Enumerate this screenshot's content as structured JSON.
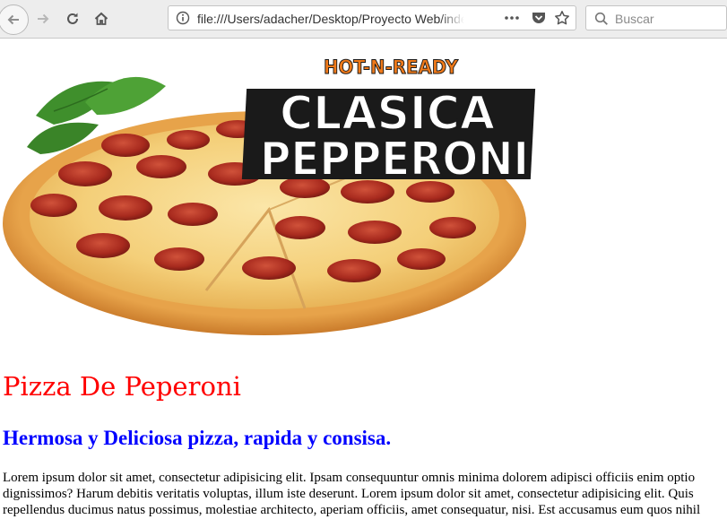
{
  "browser": {
    "url": "file:///Users/adacher/Desktop/Proyecto Web/index.html",
    "search_placeholder": "Buscar",
    "icons": [
      "back-arrow-icon",
      "forward-arrow-icon",
      "reload-icon",
      "home-icon",
      "info-icon",
      "more-dots-icon",
      "pocket-icon",
      "star-icon",
      "search-icon"
    ]
  },
  "hero": {
    "logo_top": "HOT-N-READY",
    "logo_line1": "CLASICA",
    "logo_line2": "PEPPERONI"
  },
  "page": {
    "title": "Pizza De Peperoni",
    "subtitle": "Hermosa y Deliciosa pizza, rapida y consisa.",
    "paragraph_lines": [
      "Lorem ipsum dolor sit amet, consectetur adipisicing elit. Ipsam consequuntur omnis minima dolorem adipisci officiis enim optio",
      "dignissimos? Harum debitis veritatis voluptas, illum iste deserunt. Lorem ipsum dolor sit amet, consectetur adipisicing elit. Quis",
      "repellendus ducimus natus possimus, molestiae architecto, aperiam officiis, amet consequatur, nisi. Est accusamus eum quos nihil"
    ]
  },
  "colors": {
    "title": "#ff0000",
    "subtitle": "#0000ff",
    "logo_orange": "#f07a1a",
    "toolbar_bg": "#ededed"
  }
}
